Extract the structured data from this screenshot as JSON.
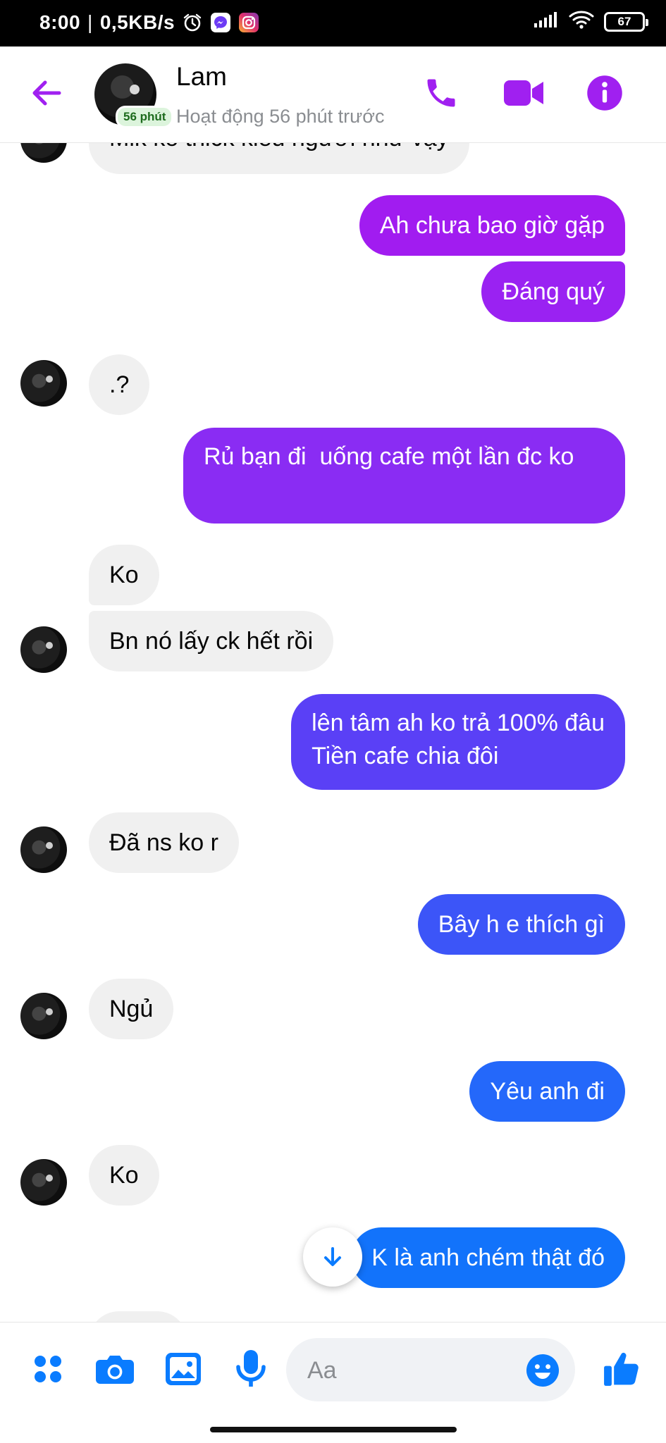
{
  "status_bar": {
    "time": "8:00",
    "speed": "0,5KB/s",
    "battery": "67"
  },
  "header": {
    "contact_name": "Lam",
    "time_badge": "56 phút",
    "active_status": "Hoạt động 56 phút trước"
  },
  "colors": {
    "accent": "#a020f0",
    "messenger_blue": "#0a7cff",
    "incoming_bg": "#f0f0f0"
  },
  "messages": [
    {
      "dir": "in",
      "text": "Mik ko thick kiểu người như vậy"
    },
    {
      "dir": "out",
      "text": "Ah chưa bao giờ gặp"
    },
    {
      "dir": "out",
      "text": "Đáng quý"
    },
    {
      "dir": "in",
      "text": ".?"
    },
    {
      "dir": "out",
      "text": "Rủ bạn đi  uống cafe một lần đc ko"
    },
    {
      "dir": "in",
      "text": "Ko"
    },
    {
      "dir": "in",
      "text": "Bn nó lấy ck hết rồi"
    },
    {
      "dir": "out",
      "text": "lên tâm ah ko trả 100% đâu\nTiền cafe chia đôi"
    },
    {
      "dir": "in",
      "text": "Đã ns ko r"
    },
    {
      "dir": "out",
      "text": "Bây h e thích gì"
    },
    {
      "dir": "in",
      "text": "Ngủ"
    },
    {
      "dir": "out",
      "text": "Yêu anh đi"
    },
    {
      "dir": "in",
      "text": "Ko"
    },
    {
      "dir": "out",
      "text": "K là anh chém thật đó"
    }
  ],
  "composer": {
    "placeholder": "Aa"
  },
  "icons": [
    "back-arrow-icon",
    "phone-icon",
    "video-icon",
    "info-icon",
    "apps-icon",
    "camera-icon",
    "image-icon",
    "microphone-icon",
    "emoji-icon",
    "thumbs-up-icon",
    "arrow-down-icon"
  ]
}
